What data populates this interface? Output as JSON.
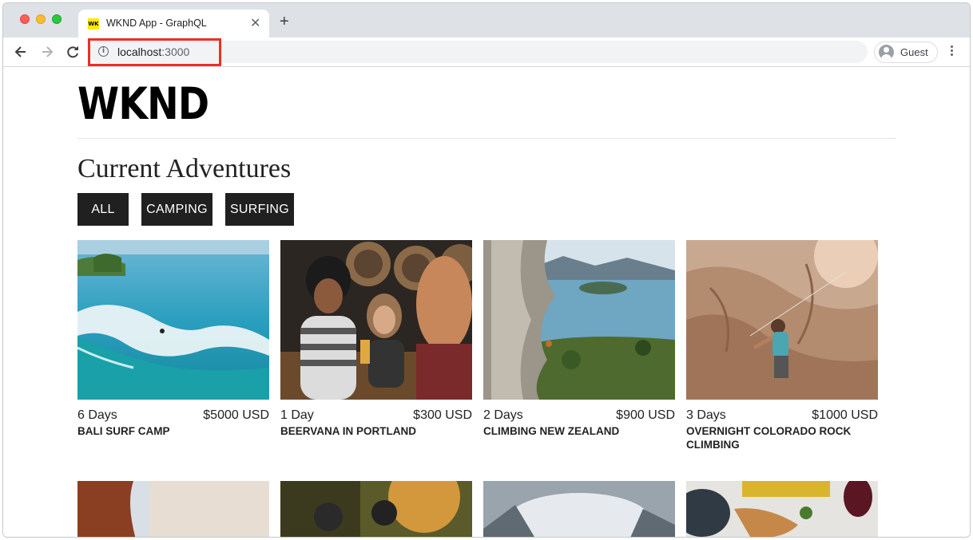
{
  "browser": {
    "tab_title": "WKND App - GraphQL",
    "favicon_text": "WK",
    "url_host": "localhost",
    "url_port": ":3000",
    "profile_label": "Guest",
    "highlight_color": "#ee2e24"
  },
  "site": {
    "logo": "WKND",
    "heading": "Current Adventures",
    "filters": [
      "ALL",
      "CAMPING",
      "SURFING"
    ]
  },
  "adventures": [
    {
      "days": "6 Days",
      "price": "$5000 USD",
      "title": "BALI SURF CAMP"
    },
    {
      "days": "1 Day",
      "price": "$300 USD",
      "title": "BEERVANA IN PORTLAND"
    },
    {
      "days": "2 Days",
      "price": "$900 USD",
      "title": "CLIMBING NEW ZEALAND"
    },
    {
      "days": "3 Days",
      "price": "$1000 USD",
      "title": "OVERNIGHT COLORADO ROCK CLIMBING"
    }
  ]
}
